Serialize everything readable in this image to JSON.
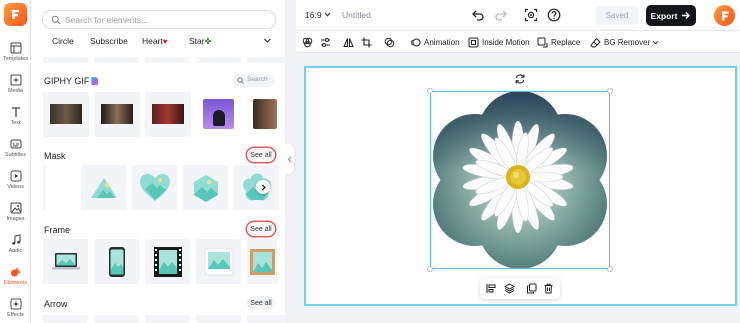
{
  "rail": {
    "items": [
      {
        "label": "Templates"
      },
      {
        "label": "Media"
      },
      {
        "label": "Text"
      },
      {
        "label": "Subtitles"
      },
      {
        "label": "Videos"
      },
      {
        "label": "Images"
      },
      {
        "label": "Audio"
      },
      {
        "label": "Elements"
      },
      {
        "label": "Effects"
      }
    ],
    "active": "Elements",
    "accent": "#f5561e"
  },
  "panel": {
    "search_placeholder": "Search for elements...",
    "chips": [
      {
        "label": "Circle"
      },
      {
        "label": "Subscribe"
      },
      {
        "label": "Heart"
      },
      {
        "label": "Star"
      }
    ],
    "giphy": {
      "title": "GIPHY GIF",
      "search_label": "Search"
    },
    "mask": {
      "title": "Mask",
      "see_all": "See all"
    },
    "frame": {
      "title": "Frame",
      "see_all": "See all"
    },
    "arrow": {
      "title": "Arrow",
      "see_all": "See all"
    }
  },
  "topbar": {
    "ratio": "16:9",
    "title": "Untitled",
    "saved": "Saved",
    "export": "Export"
  },
  "toolbar": {
    "animation": "Animation",
    "inside_motion": "Inside Motion",
    "replace": "Replace",
    "bg_remover": "BG Remover"
  },
  "colors": {
    "selection": "#4fc3d9",
    "highlight_ring": "#e25a5a",
    "export_bg": "#15161a"
  }
}
